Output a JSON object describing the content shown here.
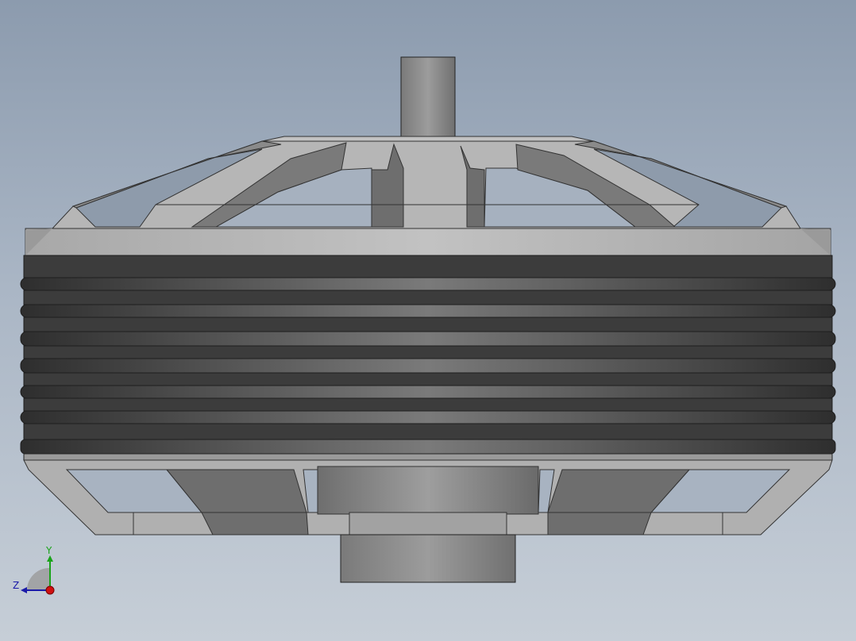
{
  "viewport": {
    "model": "motor-housing",
    "background_top": "#8c9bae",
    "background_bottom": "#c6ced7"
  },
  "triad": {
    "y_label": "Y",
    "z_label": "Z",
    "y_color": "#1aa31a",
    "z_color": "#1a1aa8",
    "x_color": "#d01010"
  },
  "colors": {
    "shaft": "#8a8a8a",
    "cage": "#b4b4b4",
    "cage_dark": "#6e6e6e",
    "coil": "#3c3c3c",
    "coil_highlight": "#8a8a8a"
  }
}
